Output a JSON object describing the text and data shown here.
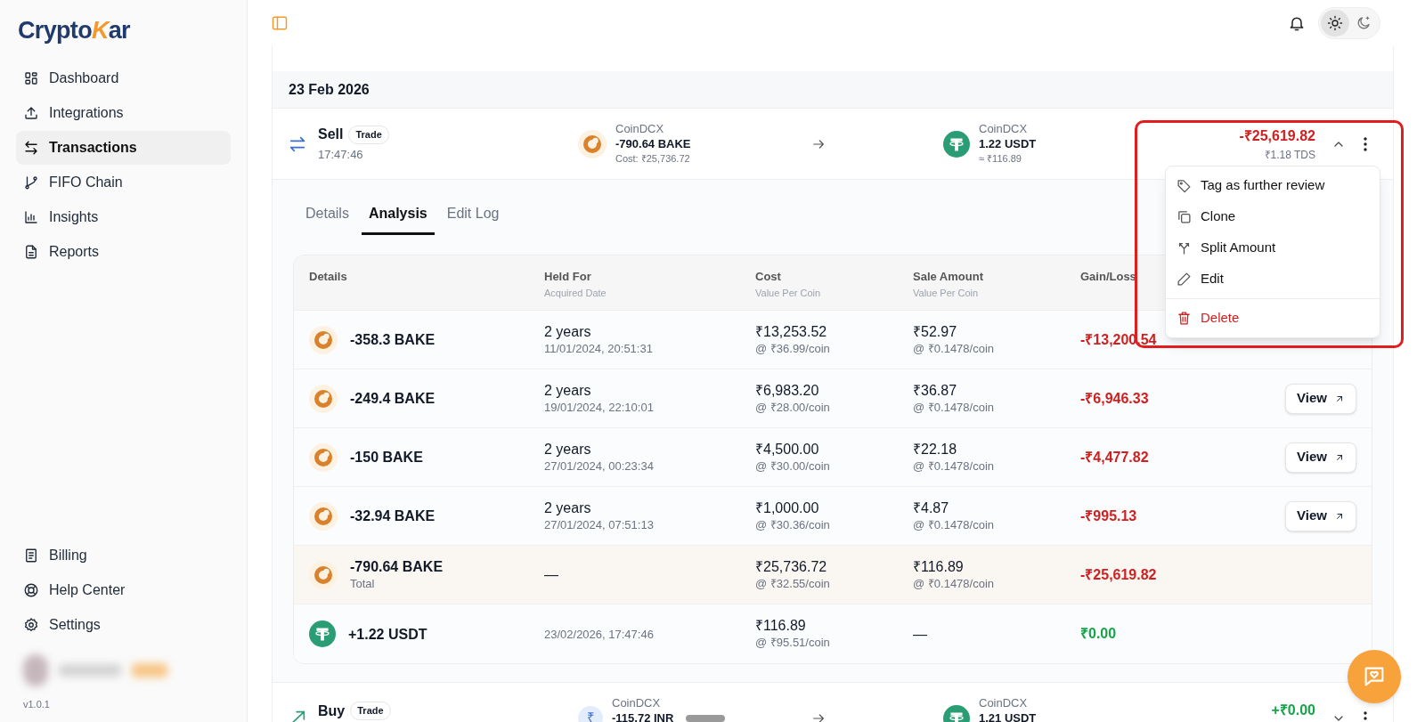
{
  "brand": {
    "start": "Crypto",
    "mark": "K",
    "end": "ar"
  },
  "sidebar": {
    "items": [
      {
        "label": "Dashboard",
        "selected": false
      },
      {
        "label": "Integrations",
        "selected": false
      },
      {
        "label": "Transactions",
        "selected": true
      },
      {
        "label": "FIFO Chain",
        "selected": false
      },
      {
        "label": "Insights",
        "selected": false
      },
      {
        "label": "Reports",
        "selected": false
      }
    ],
    "bottom_items": [
      {
        "label": "Billing"
      },
      {
        "label": "Help Center"
      },
      {
        "label": "Settings"
      }
    ],
    "version": "v1.0.1"
  },
  "theme_toggle": [
    {
      "kind": "light",
      "selected": true
    },
    {
      "kind": "dark",
      "selected": false
    }
  ],
  "date_group": "23 Feb 2026",
  "transactions": [
    {
      "kind": "sell",
      "type": "Sell",
      "badge": "Trade",
      "time": "17:47:46",
      "expanded": true,
      "from": {
        "icon": {
          "kind": "bake"
        },
        "exchange": "CoinDCX",
        "amount": "-790.64 BAKE",
        "note": "Cost: ₹25,736.72"
      },
      "to": {
        "icon": {
          "kind": "usdt"
        },
        "exchange": "CoinDCX",
        "amount": "1.22 USDT",
        "note": "≈ ₹116.89"
      },
      "result": "-₹25,619.82",
      "color": "#d11f1f",
      "tds": "₹1.18 TDS"
    },
    {
      "kind": "buy",
      "type": "Buy",
      "badge": "Trade",
      "expanded": false,
      "from": {
        "icon": {
          "kind": "inr",
          "symbol": "₹"
        },
        "exchange": "CoinDCX",
        "amount": "-115.72 INR",
        "redacted": true
      },
      "to": {
        "icon": {
          "kind": "usdt"
        },
        "exchange": "CoinDCX",
        "amount": "1.21 USDT"
      },
      "result": "+₹0.00",
      "color": "#16a34a"
    }
  ],
  "detail_tabs": [
    {
      "label": "Details",
      "selected": false
    },
    {
      "label": "Analysis",
      "selected": true
    },
    {
      "label": "Edit Log",
      "selected": false
    }
  ],
  "analysis_table": {
    "columns": [
      {
        "title": "Details"
      },
      {
        "title": "Held For",
        "subtitle": "Acquired Date"
      },
      {
        "title": "Cost",
        "subtitle": "Value Per Coin"
      },
      {
        "title": "Sale Amount",
        "subtitle": "Value Per Coin"
      },
      {
        "title": "Gain/Loss"
      }
    ],
    "rows": [
      {
        "kind": "lot",
        "icon": {
          "kind": "bake"
        },
        "amount": "-358.3 BAKE",
        "held": "2 years",
        "date": "11/01/2024, 20:51:31",
        "cost": "₹13,253.52",
        "cost_rate": "@ ₹36.99/coin",
        "sale": "₹52.97",
        "sale_rate": "@ ₹0.1478/coin",
        "gain": "-₹13,200.54",
        "color": "#d11f1f"
      },
      {
        "kind": "lot",
        "icon": {
          "kind": "bake"
        },
        "amount": "-249.4 BAKE",
        "held": "2 years",
        "date": "19/01/2024, 22:10:01",
        "cost": "₹6,983.20",
        "cost_rate": "@ ₹28.00/coin",
        "sale": "₹36.87",
        "sale_rate": "@ ₹0.1478/coin",
        "gain": "-₹6,946.33",
        "color": "#d11f1f",
        "action": "View"
      },
      {
        "kind": "lot",
        "icon": {
          "kind": "bake"
        },
        "amount": "-150 BAKE",
        "held": "2 years",
        "date": "27/01/2024, 00:23:34",
        "cost": "₹4,500.00",
        "cost_rate": "@ ₹30.00/coin",
        "sale": "₹22.18",
        "sale_rate": "@ ₹0.1478/coin",
        "gain": "-₹4,477.82",
        "color": "#d11f1f",
        "action": "View"
      },
      {
        "kind": "lot",
        "icon": {
          "kind": "bake"
        },
        "amount": "-32.94 BAKE",
        "held": "2 years",
        "date": "27/01/2024, 07:51:13",
        "cost": "₹1,000.00",
        "cost_rate": "@ ₹30.36/coin",
        "sale": "₹4.87",
        "sale_rate": "@ ₹0.1478/coin",
        "gain": "-₹995.13",
        "color": "#d11f1f",
        "action": "View"
      },
      {
        "kind": "total",
        "icon": {
          "kind": "bake"
        },
        "amount": "-790.64 BAKE",
        "label": "Total",
        "held": "—",
        "cost": "₹25,736.72",
        "cost_rate": "@ ₹32.55/coin",
        "sale": "₹116.89",
        "sale_rate": "@ ₹0.1478/coin",
        "gain": "-₹25,619.82",
        "color": "#d11f1f"
      },
      {
        "kind": "received",
        "icon": {
          "kind": "usdt"
        },
        "amount": "+1.22 USDT",
        "date": "23/02/2026, 17:47:46",
        "cost": "₹116.89",
        "cost_rate": "@ ₹95.51/coin",
        "sale": "—",
        "gain": "₹0.00",
        "color": "#16a34a"
      }
    ]
  },
  "menu": {
    "items": [
      {
        "kind": "normal",
        "label": "Tag as further review"
      },
      {
        "kind": "normal",
        "label": "Clone"
      },
      {
        "kind": "normal",
        "label": "Split Amount"
      },
      {
        "kind": "normal",
        "label": "Edit"
      },
      {
        "kind": "danger",
        "label": "Delete"
      }
    ]
  },
  "annotation": {
    "visible": true
  }
}
